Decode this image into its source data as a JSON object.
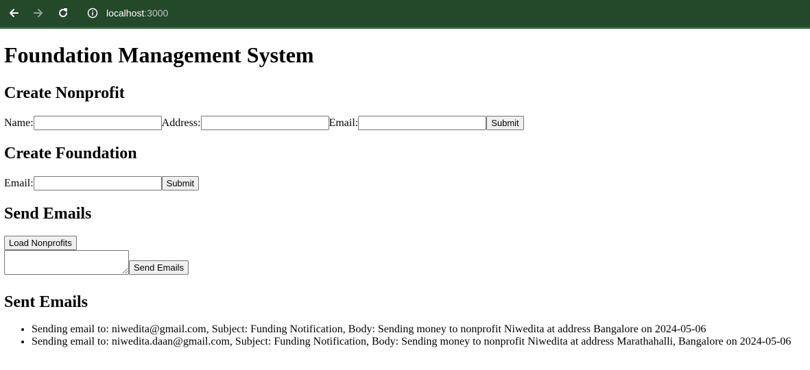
{
  "browser": {
    "url_host": "localhost",
    "url_port": ":3000"
  },
  "page": {
    "title": "Foundation Management System",
    "create_nonprofit": {
      "heading": "Create Nonprofit",
      "name_label": "Name:",
      "name_value": "",
      "address_label": "Address:",
      "address_value": "",
      "email_label": "Email:",
      "email_value": "",
      "submit_label": "Submit"
    },
    "create_foundation": {
      "heading": "Create Foundation",
      "email_label": "Email:",
      "email_value": "",
      "submit_label": "Submit"
    },
    "send_emails": {
      "heading": "Send Emails",
      "load_label": "Load Nonprofits",
      "message_value": "",
      "send_label": "Send Emails"
    },
    "sent_emails": {
      "heading": "Sent Emails",
      "items": [
        "Sending email to: niwedita@gmail.com, Subject: Funding Notification, Body: Sending money to nonprofit Niwedita at address Bangalore on 2024-05-06",
        "Sending email to: niwedita.daan@gmail.com, Subject: Funding Notification, Body: Sending money to nonprofit Niwedita at address Marathahalli, Bangalore on 2024-05-06"
      ]
    }
  }
}
